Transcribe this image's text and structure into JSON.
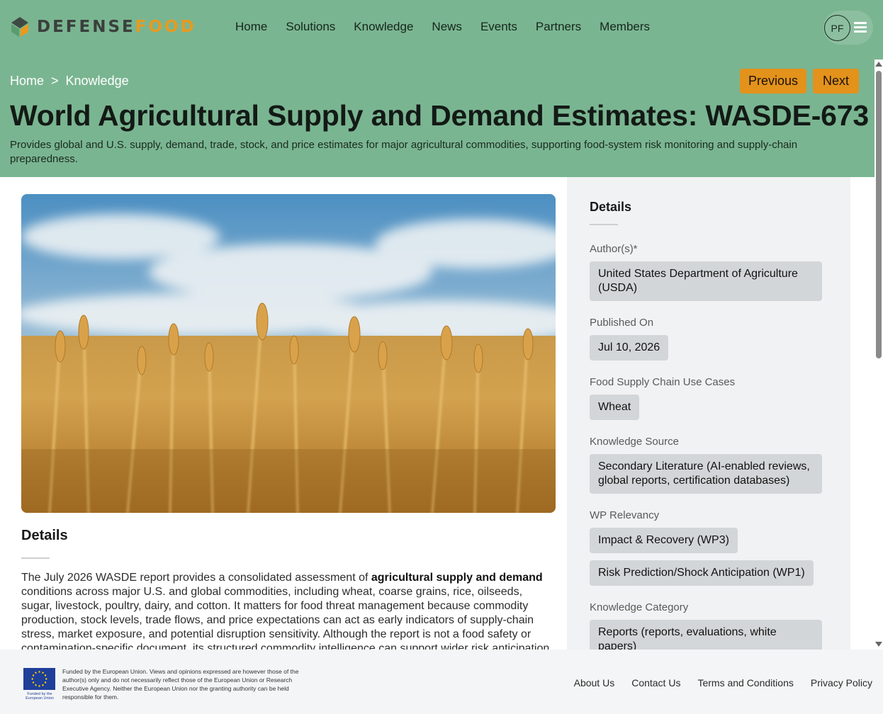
{
  "brand": {
    "part1": "DEFENSE",
    "part2": "FOOD",
    "accent": "#e89a1f",
    "header_bg": "#7ab591"
  },
  "nav": {
    "items": [
      "Home",
      "Solutions",
      "Knowledge",
      "News",
      "Events",
      "Partners",
      "Members"
    ]
  },
  "user": {
    "initials": "PF",
    "menu_icon": "hamburger-menu-icon"
  },
  "breadcrumb": {
    "items": [
      "Home",
      "Knowledge"
    ],
    "separator": ">"
  },
  "pager": {
    "previous": "Previous",
    "next": "Next"
  },
  "page": {
    "title": "World Agricultural Supply and Demand Estimates: WASDE-673",
    "subtitle": "Provides global and U.S. supply, demand, trade, stock, and price estimates for major agricultural commodities, supporting food-system risk monitoring and supply-chain preparedness."
  },
  "main": {
    "details_heading": "Details",
    "body_intro": "The July 2026 WASDE report provides a consolidated assessment of ",
    "body_bold": "agricultural supply and demand",
    "body_rest": " conditions across major U.S. and global commodities, including wheat, coarse grains, rice, oilseeds, sugar, livestock, poultry, dairy, and cotton. It matters for food threat management because commodity production, stock levels, trade flows, and price expectations can act as early indicators of supply-chain stress, market exposure, and potential disruption sensitivity. Although the report is not a food safety or contamination-specific document, its structured commodity intelligence can support wider risk anticipation by showing"
  },
  "sidebar": {
    "heading": "Details",
    "authors_label": "Author(s)*",
    "authors": "United States Department of Agriculture (USDA)",
    "published_label": "Published On",
    "published": "Jul 10, 2026",
    "use_cases_label": "Food Supply Chain Use Cases",
    "use_case": "Wheat",
    "source_label": "Knowledge Source",
    "source": "Secondary Literature (AI-enabled reviews, global reports, certification databases)",
    "wp_label": "WP Relevancy",
    "wp_1": "Impact & Recovery (WP3)",
    "wp_2": "Risk Prediction/Shock Anticipation (WP1)",
    "category_label": "Knowledge Category",
    "category": "Reports (reports, evaluations, white papers)"
  },
  "footer": {
    "eu_caption": "Funded by the European Union",
    "eu_text": "Funded by the European Union. Views and opinions expressed are however those of the author(s) only and do not necessarily reflect those of the European Union or Research Executive Agency. Neither the European Union nor the granting authority can be held responsible for them.",
    "links": [
      "About Us",
      "Contact Us",
      "Terms and Conditions",
      "Privacy Policy"
    ]
  }
}
